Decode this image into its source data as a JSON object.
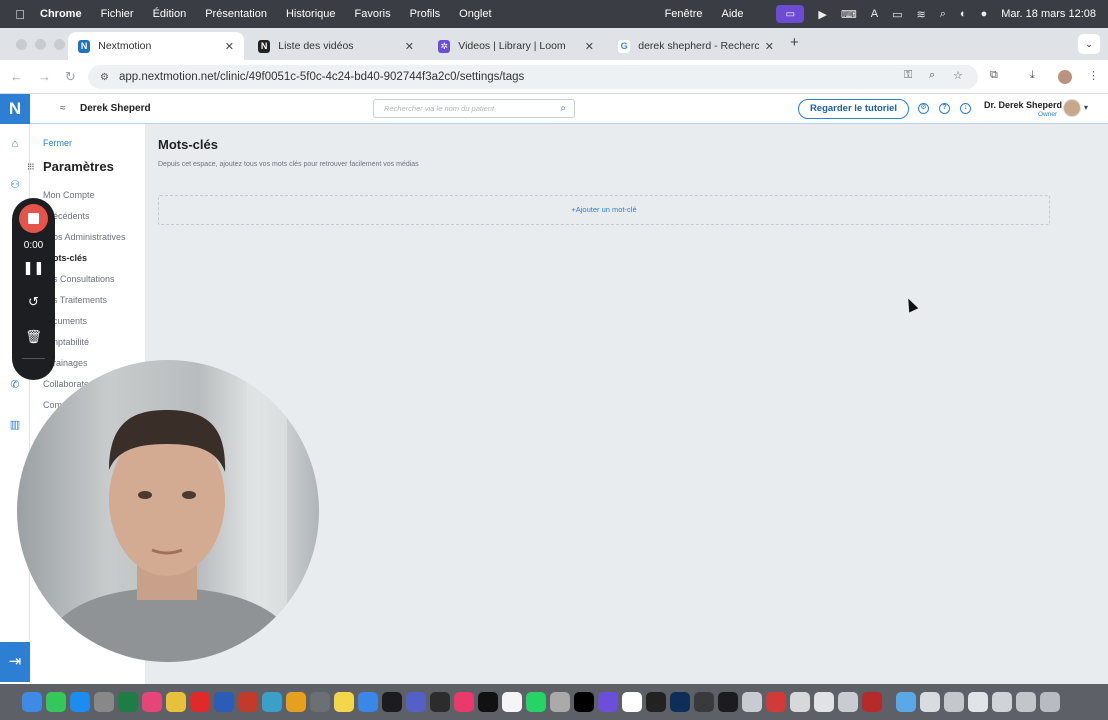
{
  "menubar": {
    "items": [
      "Chrome",
      "Fichier",
      "Édition",
      "Présentation",
      "Historique",
      "Favoris",
      "Profils",
      "Onglet"
    ],
    "right_items": [
      "Fenêtre",
      "Aide"
    ],
    "clock": "Mar. 18 mars  12:08"
  },
  "tabs": [
    {
      "title": "Nextmotion",
      "favicon": "N",
      "color": "#1e73be"
    },
    {
      "title": "Liste des vidéos",
      "favicon": "N",
      "color": "#222222"
    },
    {
      "title": "Videos | Library | Loom",
      "favicon": "✲",
      "color": "#6b4fd8"
    },
    {
      "title": "derek shepherd - Recherche",
      "favicon": "G",
      "color": "#4285f4"
    }
  ],
  "address": {
    "url": "app.nextmotion.net/clinic/49f0051c-5f0c-4c24-bd40-902744f3a2c0/settings/tags"
  },
  "app": {
    "logo": "N",
    "clinic_name": "Derek Sheperd",
    "search_placeholder": "Rechercher via le nom du patient",
    "tutorial_button": "Regarder le tutoriel",
    "user_name": "Dr. Derek Sheperd",
    "user_role": "Owner"
  },
  "settings": {
    "close_label": "Fermer",
    "title": "Paramètres",
    "items": [
      {
        "label": "Mon Compte",
        "active": false
      },
      {
        "label": "écédents",
        "active": false
      },
      {
        "label": "os Administratives",
        "active": false
      },
      {
        "label": "ots-clés",
        "active": true
      },
      {
        "label": "s Consultations",
        "active": false
      },
      {
        "label": "s Traitements",
        "active": false
      },
      {
        "label": "cuments",
        "active": false
      },
      {
        "label": "nptabilité",
        "active": false
      },
      {
        "label": "rainages",
        "active": false
      },
      {
        "label": "Collaborate",
        "active": false
      },
      {
        "label": "Comm",
        "active": false
      }
    ]
  },
  "main": {
    "title": "Mots-clés",
    "description": "Depuis cet espace, ajoutez tous vos mots clés pour retrouver facilement vos médias",
    "add_label": "+Ajouter un mot-clé"
  },
  "recorder": {
    "time": "0:00"
  }
}
